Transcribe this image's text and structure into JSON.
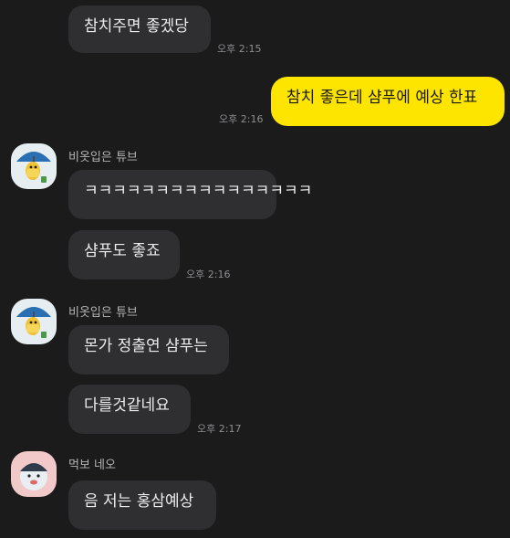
{
  "messages": {
    "m1": {
      "text": "참치주면 좋겠당",
      "time": "오후 2:15"
    },
    "m2": {
      "text": "참치 좋은데 샴푸에 예상 한표",
      "time": "오후 2:16"
    },
    "g1": {
      "sender": "비옷입은 튜브",
      "avatar_icon": "tube-raincoat-avatar-icon",
      "m1": {
        "text": "ㅋㅋㅋㅋㅋㅋㅋㅋㅋㅋㅋㅋㅋㅋㅋㅋ"
      },
      "m2": {
        "text": "샴푸도 좋죠",
        "time": "오후 2:16"
      }
    },
    "g2": {
      "sender": "비옷입은 튜브",
      "avatar_icon": "tube-raincoat-avatar-icon",
      "m1": {
        "text": "몬가 정출연 샴푸는"
      },
      "m2": {
        "text": "다를것같네요",
        "time": "오후 2:17"
      }
    },
    "g3": {
      "sender": "먹보 네오",
      "avatar_icon": "neo-avatar-icon",
      "m1": {
        "text": "음 저는 홍삼예상"
      }
    }
  },
  "colors": {
    "background": "#1b1b1c",
    "incoming_bubble": "#2f2f31",
    "outgoing_bubble": "#fee500",
    "timestamp": "#8e8e90"
  }
}
